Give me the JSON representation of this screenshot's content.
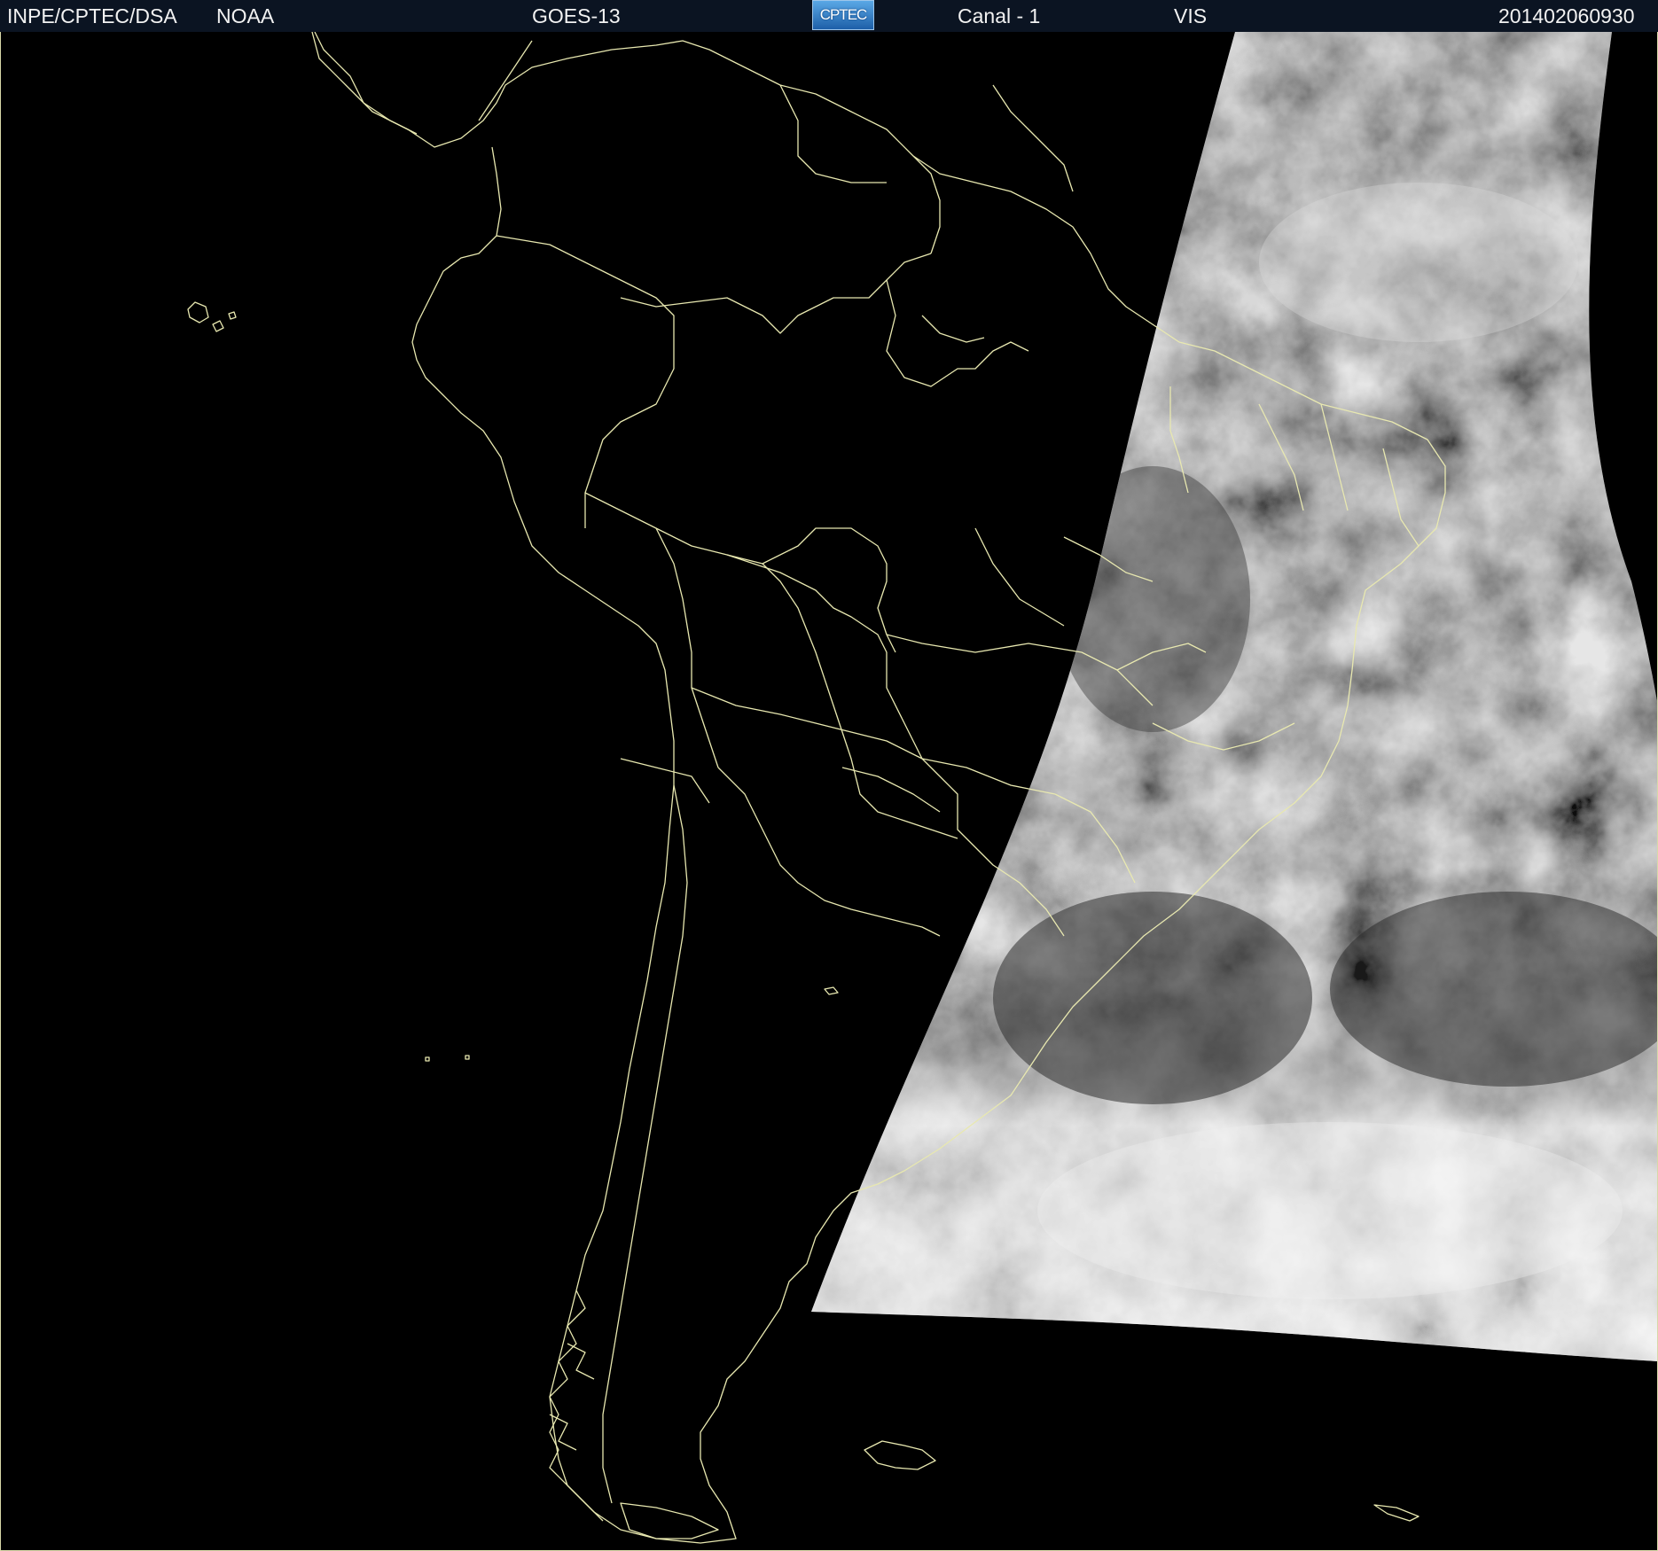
{
  "header": {
    "agency": "INPE/CPTEC/DSA",
    "source": "NOAA",
    "satellite": "GOES-13",
    "logo_text": "CPTEC",
    "channel": "Canal - 1",
    "band": "VIS",
    "timestamp": "201402060930"
  },
  "colors": {
    "background": "#000000",
    "header_bar": "#0b1422",
    "coastline": "#e8e8b0",
    "header_text": "#f2f2f2"
  },
  "map": {
    "type": "satellite-visible-image",
    "region": "South America",
    "illuminated_area": "east (dawn terminator)"
  }
}
